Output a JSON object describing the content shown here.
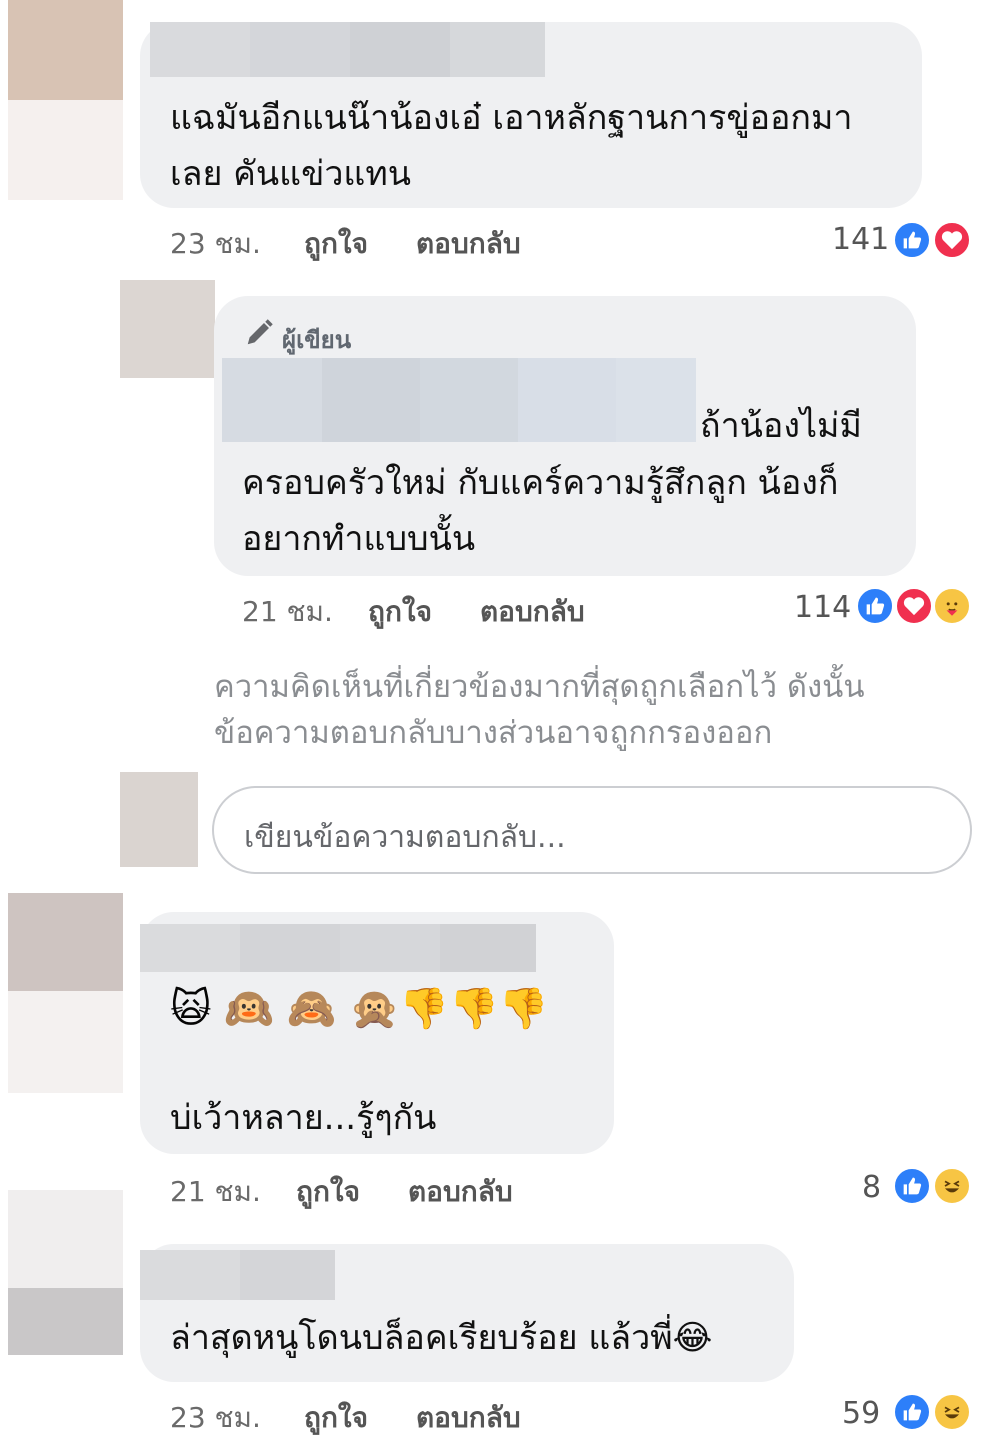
{
  "comments": [
    {
      "text_lines": [
        "แฉมันอีกแนน๊าน้องเอ๋ เอาหลักฐานการขู่ออกมา",
        "เลย คันแข่วแทน"
      ],
      "time": "23 ชม.",
      "like": "ถูกใจ",
      "reply": "ตอบกลับ",
      "reaction_count": "141",
      "reactions": [
        "like-icon",
        "love-icon"
      ]
    },
    {
      "author_badge": "ผู้เขียน",
      "text_lines": [
        "ถ้าน้องไม่มี",
        "ครอบครัวใหม่ กับแคร์ความรู้สึกลูก น้องก็",
        "อยากทำแบบนั้น"
      ],
      "time": "21 ชม.",
      "like": "ถูกใจ",
      "reply": "ตอบกลับ",
      "reaction_count": "114",
      "reactions": [
        "like-icon",
        "love-icon",
        "care-icon"
      ]
    },
    {
      "emoji_line": "🙀 🙉 🙈 🙊👎👎👎",
      "text_lines": [
        "บ่เว้าหลาย...รู้ๆกัน"
      ],
      "time": "21 ชม.",
      "like": "ถูกใจ",
      "reply": "ตอบกลับ",
      "reaction_count": "8",
      "reactions": [
        "like-icon",
        "haha-icon"
      ]
    },
    {
      "text_lines": [
        "ล่าสุดหนูโดนบล็อคเรียบร้อย แล้วพี่😂"
      ],
      "time": "23 ชม.",
      "like": "ถูกใจ",
      "reply": "ตอบกลับ",
      "reaction_count": "59",
      "reactions": [
        "like-icon",
        "haha-icon"
      ]
    }
  ],
  "notice": [
    "ความคิดเห็นที่เกี่ยวข้องมากที่สุดถูกเลือกไว้ ดังนั้น",
    "ข้อความตอบกลับบางส่วนอาจถูกกรองออก"
  ],
  "reply_placeholder": "เขียนข้อความตอบกลับ...",
  "colors": {
    "bubble": "#eff0f2",
    "like": "#2d7ff9",
    "love": "#f0304f",
    "haha": "#f7c544",
    "meta_text": "#65676b"
  }
}
